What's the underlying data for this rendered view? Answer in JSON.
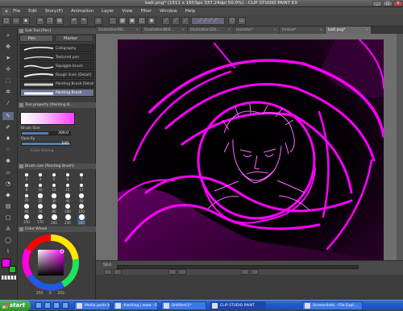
{
  "title": "batt.png* (1511 x 1653px 337.24dpi 50.0%) - CLIP STUDIO PAINT EX",
  "menu": [
    "File",
    "Edit",
    "Story(P)",
    "Animation",
    "Layer",
    "View",
    "Filter",
    "Window",
    "Help"
  ],
  "doc_tabs": [
    {
      "label": "illustration90r...",
      "active": false
    },
    {
      "label": "illustration8h9...",
      "active": false
    },
    {
      "label": "illustration32h...",
      "active": false
    },
    {
      "label": "monster*",
      "active": false
    },
    {
      "label": "limisse*",
      "active": false
    },
    {
      "label": "batt.png*",
      "active": true
    }
  ],
  "subtool": {
    "header": "Sub Tool [Pen]",
    "tabs": [
      "Pen",
      "Marker"
    ],
    "brushes": [
      {
        "label": "Calligraphy",
        "selected": false
      },
      {
        "label": "Textured pen",
        "selected": false
      },
      {
        "label": "Squiggle brush",
        "selected": false
      },
      {
        "label": "Rough lines (Detail)",
        "selected": false
      },
      {
        "label": "Painting Brush  Detail",
        "selected": false
      },
      {
        "label": "Painting Brush",
        "selected": true
      }
    ]
  },
  "tool_property": {
    "header": "Tool property [Painting B...",
    "brush_size_label": "Brush Size",
    "brush_size_value": "300.0",
    "brush_size_level": 0.55,
    "opacity_label": "Opacity",
    "opacity_value": "100",
    "opacity_level": 1.0,
    "color_mixing_label": "Color mixing"
  },
  "brush_size_panel": {
    "header": "Brush size [Painting Brush]",
    "sizes": [
      "3",
      "4",
      "5",
      "6",
      "7",
      "8",
      "10",
      "12",
      "15",
      "17",
      "20",
      "25",
      "30",
      "40",
      "50",
      "60",
      "70",
      "80",
      "100",
      "120",
      "150",
      "170",
      "200",
      "250",
      "300"
    ],
    "selected": "300"
  },
  "color_wheel": {
    "header": "Color Wheel",
    "values": [
      "255",
      "0",
      "255"
    ]
  },
  "colors": {
    "main": "#ff00ff",
    "sub": "#22c022",
    "line_art": "#ff00ff"
  },
  "status": {
    "zoom": "50.0"
  },
  "taskbar": {
    "start": "start",
    "tasks": [
      {
        "label": "Media posts by ...",
        "selected": false
      },
      {
        "label": "#writing | www - Disco...",
        "selected": false
      },
      {
        "label": "Untitled-1*",
        "selected": false
      },
      {
        "label": "CLIP STUDIO PAINT",
        "selected": true
      },
      {
        "label": "Screenshots - File Expl...",
        "selected": false
      }
    ]
  }
}
